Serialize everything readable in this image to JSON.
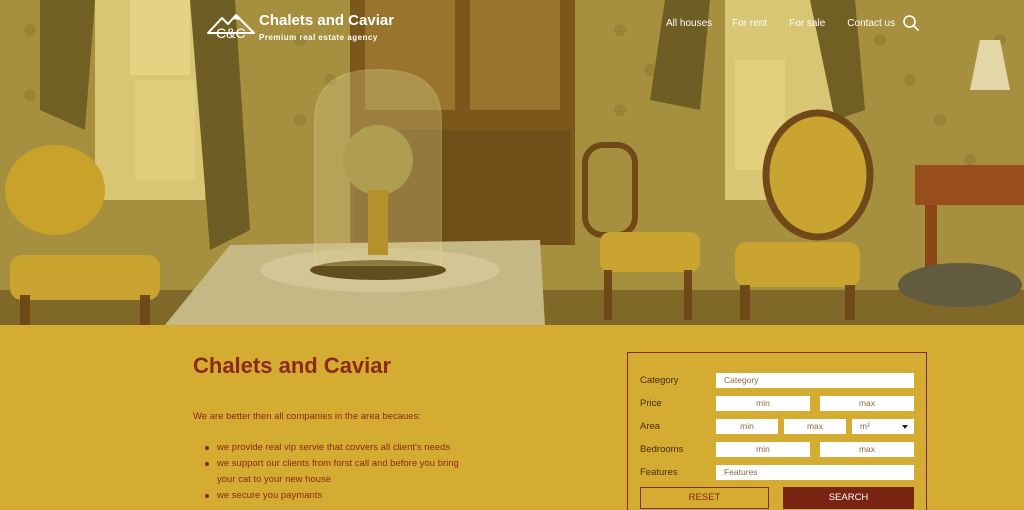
{
  "header": {
    "logo_mark": "C&C",
    "brand_name": "Chalets and Caviar",
    "tagline": "Premium real estate agency",
    "nav": [
      {
        "label": "All houses"
      },
      {
        "label": "For rent"
      },
      {
        "label": "For sale"
      },
      {
        "label": "Contact us"
      }
    ],
    "search_icon": "search-icon"
  },
  "main": {
    "title": "Chalets and Caviar",
    "intro": "We are better then all companies in the area becaues:",
    "features": [
      "we provide real vip servie that covvers all client's needs",
      "we support our clients from forst call and before you bring your cat to your new house",
      "we secure you paymants"
    ]
  },
  "search_form": {
    "category_label": "Category",
    "category_placeholder": "Category",
    "price_label": "Price",
    "price_min": "min",
    "price_max": "max",
    "area_label": "Area",
    "area_min": "min",
    "area_max": "max",
    "area_unit": "m²",
    "bedrooms_label": "Bedrooms",
    "bedrooms_min": "min",
    "bedrooms_max": "max",
    "features_label": "Features",
    "features_placeholder": "Features",
    "reset_label": "RESET",
    "search_label": "SEARCH"
  },
  "colors": {
    "background": "#d4ac32",
    "accent": "#8a2a18",
    "button": "#7a2414"
  }
}
